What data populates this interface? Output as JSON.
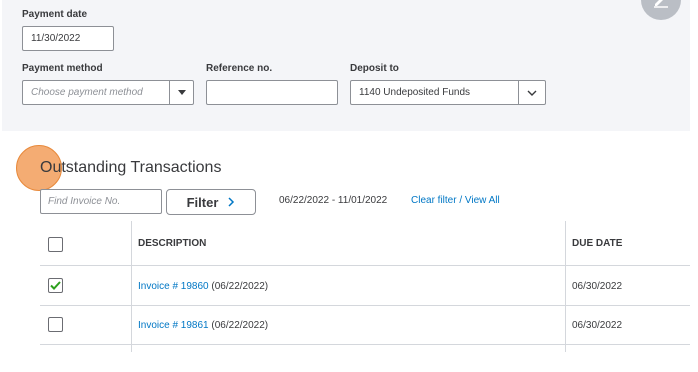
{
  "payment_date": {
    "label": "Payment date",
    "value": "11/30/2022"
  },
  "payment_method": {
    "label": "Payment method",
    "placeholder": "Choose payment method"
  },
  "reference_no": {
    "label": "Reference no.",
    "value": ""
  },
  "deposit_to": {
    "label": "Deposit to",
    "value": "1140 Undeposited Funds"
  },
  "outstanding": {
    "title": "Outstanding Transactions",
    "find_placeholder": "Find Invoice No.",
    "filter_label": "Filter",
    "date_range": "06/22/2022 - 11/01/2022",
    "clear_filter": "Clear filter / View All"
  },
  "table": {
    "headers": {
      "description": "DESCRIPTION",
      "due_date": "DUE DATE"
    },
    "rows": [
      {
        "checked": true,
        "invoice_link": "Invoice # 19860",
        "invoice_date": " (06/22/2022)",
        "due_date": "06/30/2022"
      },
      {
        "checked": false,
        "invoice_link": "Invoice # 19861",
        "invoice_date": " (06/22/2022)",
        "due_date": "06/30/2022"
      }
    ]
  },
  "colors": {
    "panel": "#f4f5f8",
    "link": "#0077c5",
    "check": "#2ca01c",
    "highlight": "#f29e5a"
  }
}
